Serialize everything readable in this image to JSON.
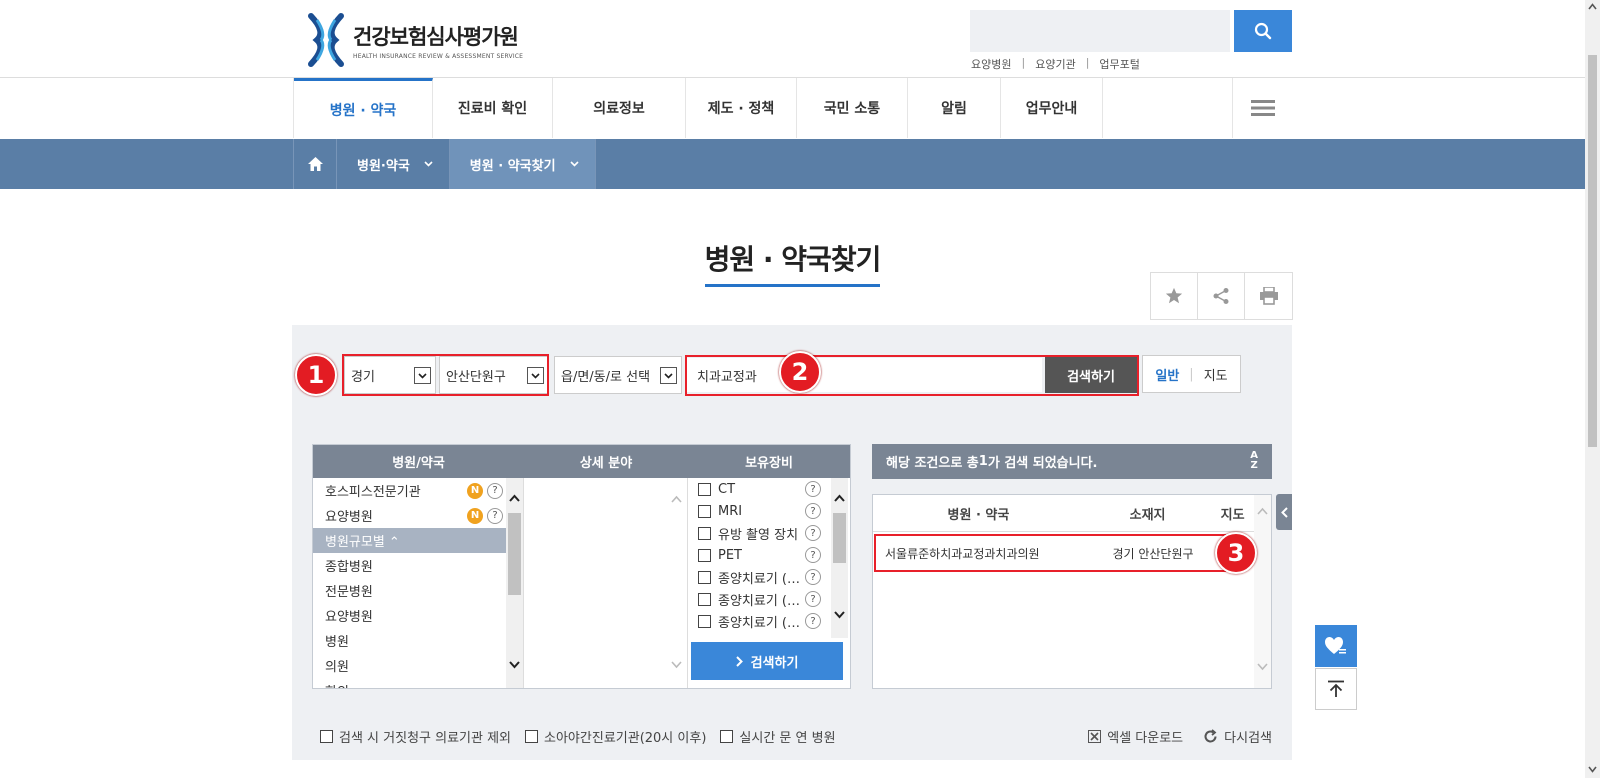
{
  "brand": {
    "name": "건강보험심사평가원",
    "tagline": "HEALTH INSURANCE REVIEW & ASSESSMENT SERVICE"
  },
  "quick_links": [
    "요양병원",
    "요양기관",
    "업무포털"
  ],
  "gnb": [
    "병원 · 약국",
    "진료비 확인",
    "의료정보",
    "제도 · 정책",
    "국민 소통",
    "알림",
    "업무안내"
  ],
  "breadcrumb": [
    "병원·약국",
    "병원 · 약국찾기"
  ],
  "page_title": "병원 · 약국찾기",
  "search": {
    "sido": "경기",
    "sigungu": "안산단원구",
    "emd": "읍/면/동/로 선택",
    "keyword": "치과교정과",
    "button": "검색하기",
    "view_normal": "일반",
    "view_map": "지도"
  },
  "annotations": [
    "1",
    "2",
    "3"
  ],
  "filter": {
    "headers": [
      "병원/약국",
      "상세 분야",
      "보유장비"
    ],
    "categories": [
      {
        "label": "호스피스전문기관",
        "new": "N",
        "help": "?"
      },
      {
        "label": "요양병원",
        "new": "N",
        "help": "?"
      },
      {
        "label": "병원규모별 ⌃",
        "group": true
      },
      {
        "label": "종합병원"
      },
      {
        "label": "전문병원"
      },
      {
        "label": "요양병원"
      },
      {
        "label": "병원"
      },
      {
        "label": "의원"
      },
      {
        "label": "한의"
      }
    ],
    "equipment": [
      "CT",
      "MRI",
      "유방 촬영 장치",
      "PET",
      "종양치료기 (…",
      "종양치료기 (…",
      "종양치료기 (…"
    ],
    "search_button": "검색하기"
  },
  "result": {
    "summary_pre": "해당 조건으로 총 ",
    "count": "1",
    "summary_post": "가 검색 되었습니다.",
    "sort_label": "A\nZ",
    "columns": [
      "병원 · 약국",
      "소재지",
      "지도"
    ],
    "rows": [
      {
        "name": "서울류준하치과교정과치과의원",
        "location": "경기 안산단원구"
      }
    ]
  },
  "options": {
    "exclude_fraud": "검색 시 거짓청구 의료기관 제외",
    "pediatric_night": "소아야간진료기관(20시 이후)",
    "realtime_open": "실시간 문 연 병원",
    "excel": "엑셀 다운로드",
    "research": "다시검색"
  },
  "colors": {
    "accent": "#2573c8",
    "lnb": "#5a7ea6",
    "annotation_red": "#e31c23"
  }
}
